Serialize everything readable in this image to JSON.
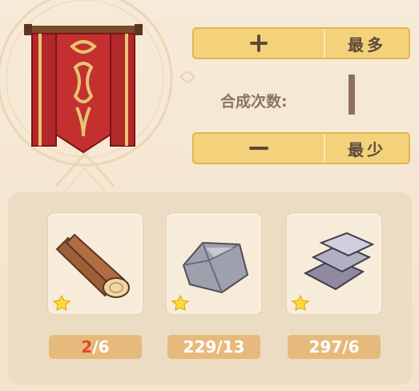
{
  "controls": {
    "increase_max_label": "最多",
    "decrease_min_label": "最少",
    "count_label": "合成次数:",
    "count_value": "1"
  },
  "materials": [
    {
      "icon": "wood-log-icon",
      "have": "2",
      "need": "6",
      "insufficient": true
    },
    {
      "icon": "stone-ore-icon",
      "have": "229",
      "need": "13",
      "insufficient": false
    },
    {
      "icon": "metal-ingot-icon",
      "have": "297",
      "need": "6",
      "insufficient": false
    }
  ],
  "colors": {
    "button_fill": "#f3d27b",
    "pill_fill": "#e6ba7c",
    "insufficient": "#e8432f",
    "banner_red": "#b3282a"
  }
}
